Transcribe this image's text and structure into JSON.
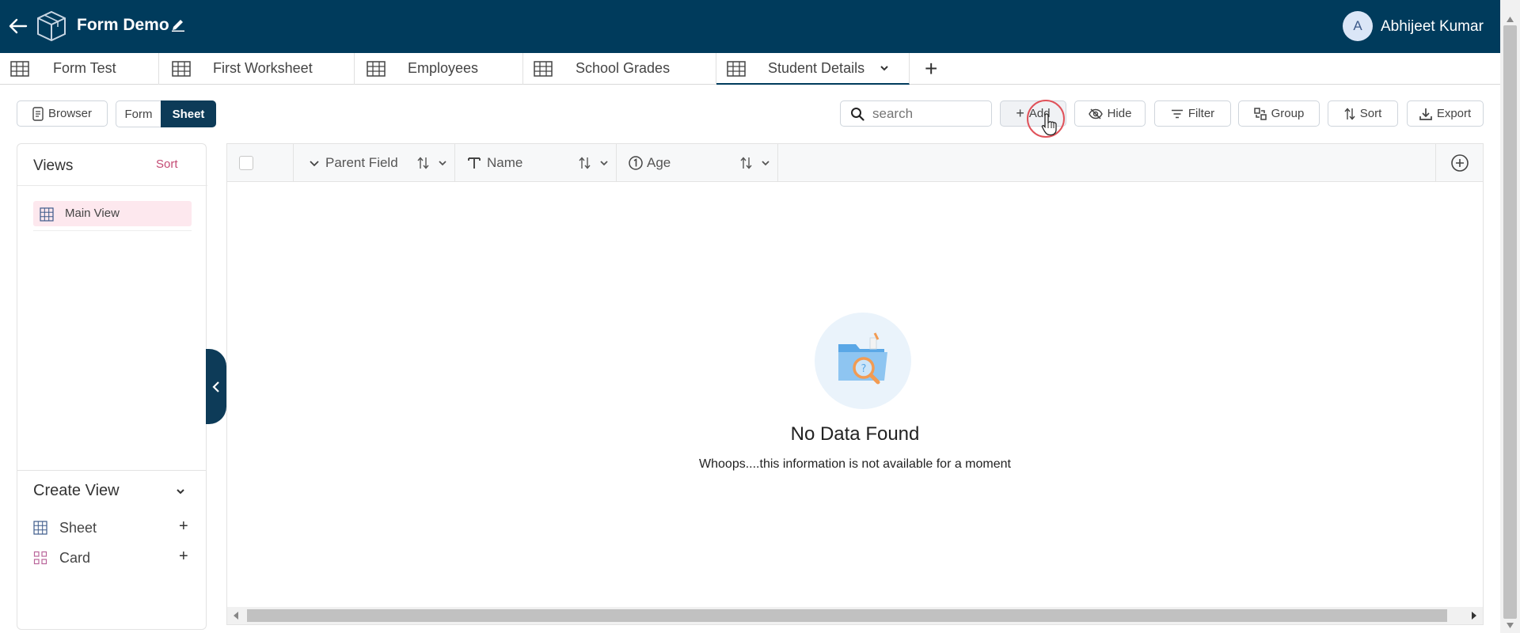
{
  "header": {
    "title": "Form Demo",
    "user_initial": "A",
    "user_name": "Abhijeet Kumar"
  },
  "tabs": [
    {
      "label": "Form Test"
    },
    {
      "label": "First Worksheet"
    },
    {
      "label": "Employees"
    },
    {
      "label": "School Grades"
    },
    {
      "label": "Student Details",
      "active": true
    }
  ],
  "toolbar": {
    "browser_label": "Browser",
    "form_label": "Form",
    "sheet_label": "Sheet",
    "search_placeholder": "search",
    "add_label": "Add",
    "hide_label": "Hide",
    "filter_label": "Filter",
    "group_label": "Group",
    "sort_label": "Sort",
    "export_label": "Export"
  },
  "views": {
    "title": "Views",
    "sort_label": "Sort",
    "items": [
      {
        "label": "Main View"
      }
    ]
  },
  "create_view": {
    "title": "Create View",
    "items": [
      {
        "label": "Sheet",
        "plus": "+"
      },
      {
        "label": "Card",
        "plus": "+"
      }
    ]
  },
  "grid": {
    "columns": [
      {
        "label": "Parent Field",
        "icon": "chevron-down-icon"
      },
      {
        "label": "Name",
        "icon": "text-type-icon"
      },
      {
        "label": "Age",
        "icon": "number-type-icon"
      }
    ],
    "empty_title": "No Data Found",
    "empty_message": "Whoops....this information is not available for a moment"
  },
  "colors": {
    "brand": "#003b5c",
    "accent_pink": "#c44b74",
    "highlight_ring": "#e0525a"
  }
}
